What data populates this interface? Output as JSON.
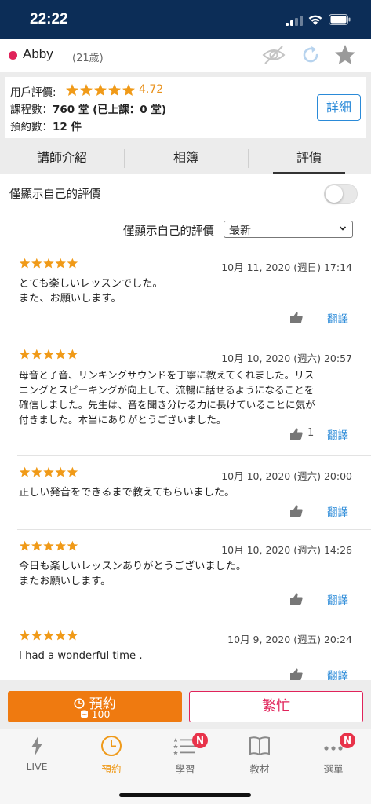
{
  "status_bar": {
    "time": "22:22"
  },
  "header": {
    "name": "Abby",
    "age": "(21歲)",
    "online_color": "#e0235a",
    "icons": [
      "eye-off-icon",
      "refresh-icon",
      "star-icon"
    ]
  },
  "info": {
    "rating_label": "用戶評價:",
    "rating_stars": 5,
    "rating_value": "4.72",
    "lessons_label": "課程數：",
    "lessons_value": "760 堂 (已上課：0 堂)",
    "bookings_label": "預約數：",
    "bookings_value": "12 件",
    "detail_button": "詳細"
  },
  "tabs": [
    {
      "label": "講師介紹",
      "active": false
    },
    {
      "label": "相簿",
      "active": false
    },
    {
      "label": "評價",
      "active": true
    }
  ],
  "own_only": {
    "label": "僅顯示自己的評價",
    "enabled": false
  },
  "sort": {
    "label": "僅顯示自己的評價",
    "selected": "最新"
  },
  "reviews": [
    {
      "stars": 5,
      "date": "10月 11, 2020 (週日) 17:14",
      "lines": [
        "とても楽しいレッスンでした。",
        "また、お願いします。"
      ],
      "likes": "",
      "translate": "翻譯"
    },
    {
      "stars": 5,
      "date": "10月 10, 2020 (週六) 20:57",
      "lines": [
        "母音と子音、リンキングサウンドを丁寧に教えてくれました。リス",
        "ニングとスピーキングが向上して、流暢に話せるようになることを",
        "確信しました。先生は、音を聞き分ける力に長けていることに気が",
        "付きました。本当にありがとうございました。"
      ],
      "likes": "1",
      "translate": "翻譯"
    },
    {
      "stars": 5,
      "date": "10月 10, 2020 (週六) 20:00",
      "lines": [
        "正しい発音をできるまで教えてもらいました。"
      ],
      "likes": "",
      "translate": "翻譯"
    },
    {
      "stars": 5,
      "date": "10月 10, 2020 (週六) 14:26",
      "lines": [
        "今日も楽しいレッスンありがとうございました。",
        "またお願いします。"
      ],
      "likes": "",
      "translate": "翻譯"
    },
    {
      "stars": 5,
      "date": "10月 9, 2020 (週五) 20:24",
      "lines": [
        "I had a wonderful time ."
      ],
      "likes": "",
      "translate": "翻譯"
    }
  ],
  "actions": {
    "book_label": "預約",
    "book_coins": "100",
    "busy_label": "繁忙",
    "book_color": "#ef7a10",
    "busy_color": "#e0235a"
  },
  "nav": [
    {
      "label": "LIVE",
      "icon": "lightning-icon",
      "badge": "",
      "active": false
    },
    {
      "label": "預約",
      "icon": "clock-icon",
      "badge": "",
      "active": true
    },
    {
      "label": "學習",
      "icon": "list-icon",
      "badge": "N",
      "active": false
    },
    {
      "label": "教材",
      "icon": "book-icon",
      "badge": "",
      "active": false
    },
    {
      "label": "選單",
      "icon": "more-icon",
      "badge": "N",
      "active": false
    }
  ],
  "colors": {
    "accent": "#ef9a1a",
    "link": "#2a8ad8",
    "star": "#f09a18",
    "status_bar": "#0c2d57"
  }
}
